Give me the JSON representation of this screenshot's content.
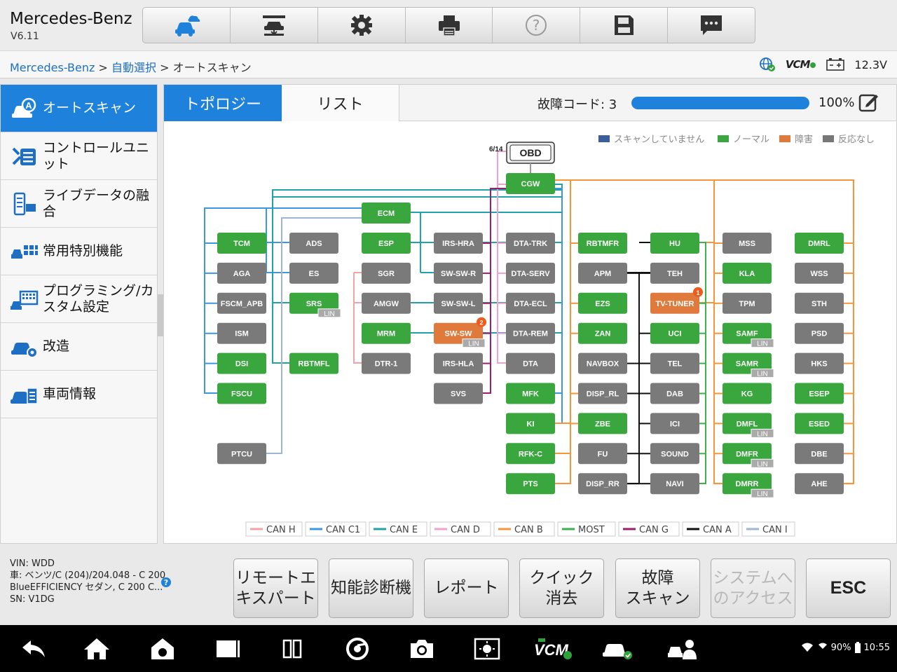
{
  "header": {
    "title": "Mercedes-Benz",
    "version": "V6.11",
    "toolbar": [
      {
        "name": "vehicle-diagnosis",
        "icon": "car-cloud-icon"
      },
      {
        "name": "lift",
        "icon": "car-lift-icon"
      },
      {
        "name": "settings",
        "icon": "gear-icon"
      },
      {
        "name": "print",
        "icon": "printer-icon"
      },
      {
        "name": "help",
        "icon": "question-icon"
      },
      {
        "name": "save",
        "icon": "save-icon"
      },
      {
        "name": "message",
        "icon": "chat-icon"
      }
    ]
  },
  "breadcrumb": {
    "part1": "Mercedes-Benz",
    "sep1": " > ",
    "part2": "自動選択",
    "sep2": " > ",
    "part3": "オートスキャン"
  },
  "status": {
    "vcm": "VCM",
    "voltage": "12.3V"
  },
  "sidebar": {
    "items": [
      {
        "label": "オートスキャン",
        "icon": "auto-scan-icon",
        "active": true
      },
      {
        "label": "コントロールユニット",
        "icon": "control-unit-icon"
      },
      {
        "label": "ライブデータの融合",
        "icon": "live-data-icon"
      },
      {
        "label": "常用特別機能",
        "icon": "special-function-icon"
      },
      {
        "label": "プログラミング/カスタム設定",
        "icon": "programming-icon"
      },
      {
        "label": "改造",
        "icon": "modify-icon"
      },
      {
        "label": "車両情報",
        "icon": "vehicle-info-icon"
      }
    ]
  },
  "tabs": {
    "topology": "トポロジー",
    "list": "リスト"
  },
  "scan": {
    "fault_label": "故障コード: 3",
    "progress": 100,
    "progress_text": "100%"
  },
  "legend_status": [
    {
      "label": "スキャンしていません",
      "color": "#3a5f9a"
    },
    {
      "label": "ノーマル",
      "color": "#3aa63e"
    },
    {
      "label": "障害",
      "color": "#e07a3c"
    },
    {
      "label": "反応なし",
      "color": "#777777"
    }
  ],
  "topology": {
    "obd": "OBD",
    "obd_count": "6/14",
    "status_colors": {
      "normal": "#3aa63e",
      "fault": "#e07a3c",
      "none": "#7a7a7a"
    },
    "nodes": [
      {
        "id": "CGW",
        "col": "g",
        "row": "cgw",
        "s": "normal"
      },
      {
        "id": "ECM",
        "col": "c",
        "row": "ecm",
        "s": "normal"
      },
      {
        "id": "TCM",
        "col": "a",
        "row": 0,
        "s": "normal"
      },
      {
        "id": "AGA",
        "col": "a",
        "row": 1,
        "s": "none"
      },
      {
        "id": "FSCM_APB",
        "col": "a",
        "row": 2,
        "s": "none"
      },
      {
        "id": "ISM",
        "col": "a",
        "row": 3,
        "s": "none"
      },
      {
        "id": "DSI",
        "col": "a",
        "row": 4,
        "s": "normal"
      },
      {
        "id": "FSCU",
        "col": "a",
        "row": 5,
        "s": "normal"
      },
      {
        "id": "PTCU",
        "col": "a",
        "row": 7,
        "s": "none"
      },
      {
        "id": "ADS",
        "col": "b",
        "row": 0,
        "s": "none"
      },
      {
        "id": "ES",
        "col": "b",
        "row": 1,
        "s": "none"
      },
      {
        "id": "SRS",
        "col": "b",
        "row": 2,
        "s": "normal",
        "lin": "LIN"
      },
      {
        "id": "RBTMFL",
        "col": "b",
        "row": 4,
        "s": "normal"
      },
      {
        "id": "ESP",
        "col": "c",
        "row": 0,
        "s": "normal"
      },
      {
        "id": "SGR",
        "col": "c",
        "row": 1,
        "s": "none"
      },
      {
        "id": "AMGW",
        "col": "c",
        "row": 2,
        "s": "none"
      },
      {
        "id": "MRM",
        "col": "c",
        "row": 3,
        "s": "normal"
      },
      {
        "id": "DTR-1",
        "col": "c",
        "row": 4,
        "s": "none"
      },
      {
        "id": "IRS-HRA",
        "col": "d",
        "row": 0,
        "s": "none"
      },
      {
        "id": "SW-SW-R",
        "col": "d",
        "row": 1,
        "s": "none"
      },
      {
        "id": "SW-SW-L",
        "col": "d",
        "row": 2,
        "s": "none"
      },
      {
        "id": "SW-SW",
        "col": "d",
        "row": 3,
        "s": "fault",
        "lin": "LIN",
        "badge": "2"
      },
      {
        "id": "IRS-HLA",
        "col": "d",
        "row": 4,
        "s": "none"
      },
      {
        "id": "SVS",
        "col": "d",
        "row": 5,
        "s": "none"
      },
      {
        "id": "DTA-TRK",
        "col": "e",
        "row": 0,
        "s": "none"
      },
      {
        "id": "DTA-SERV",
        "col": "e",
        "row": 1,
        "s": "none"
      },
      {
        "id": "DTA-ECL",
        "col": "e",
        "row": 2,
        "s": "none"
      },
      {
        "id": "DTA-REM",
        "col": "e",
        "row": 3,
        "s": "none"
      },
      {
        "id": "DTA",
        "col": "e",
        "row": 4,
        "s": "none"
      },
      {
        "id": "MFK",
        "col": "e",
        "row": 5,
        "s": "normal"
      },
      {
        "id": "KI",
        "col": "e",
        "row": 6,
        "s": "normal"
      },
      {
        "id": "RFK-C",
        "col": "e",
        "row": 7,
        "s": "normal"
      },
      {
        "id": "PTS",
        "col": "e",
        "row": 8,
        "s": "normal"
      },
      {
        "id": "RBTMFR",
        "col": "f",
        "row": 0,
        "s": "normal"
      },
      {
        "id": "APM",
        "col": "f",
        "row": 1,
        "s": "none"
      },
      {
        "id": "EZS",
        "col": "f",
        "row": 2,
        "s": "normal"
      },
      {
        "id": "ZAN",
        "col": "f",
        "row": 3,
        "s": "normal"
      },
      {
        "id": "NAVBOX",
        "col": "f",
        "row": 4,
        "s": "none"
      },
      {
        "id": "DISP_RL",
        "col": "f",
        "row": 5,
        "s": "none"
      },
      {
        "id": "ZBE",
        "col": "f",
        "row": 6,
        "s": "normal"
      },
      {
        "id": "FU",
        "col": "f",
        "row": 7,
        "s": "none"
      },
      {
        "id": "DISP_RR",
        "col": "f",
        "row": 8,
        "s": "none"
      },
      {
        "id": "HU",
        "col": "h",
        "row": 0,
        "s": "normal"
      },
      {
        "id": "TEH",
        "col": "h",
        "row": 1,
        "s": "none"
      },
      {
        "id": "TV-TUNER",
        "col": "h",
        "row": 2,
        "s": "fault",
        "badge": "1"
      },
      {
        "id": "UCI",
        "col": "h",
        "row": 3,
        "s": "normal"
      },
      {
        "id": "TEL",
        "col": "h",
        "row": 4,
        "s": "none"
      },
      {
        "id": "DAB",
        "col": "h",
        "row": 5,
        "s": "none"
      },
      {
        "id": "ICI",
        "col": "h",
        "row": 6,
        "s": "none"
      },
      {
        "id": "SOUND",
        "col": "h",
        "row": 7,
        "s": "none"
      },
      {
        "id": "NAVI",
        "col": "h",
        "row": 8,
        "s": "none"
      },
      {
        "id": "MSS",
        "col": "i",
        "row": 0,
        "s": "none"
      },
      {
        "id": "KLA",
        "col": "i",
        "row": 1,
        "s": "normal"
      },
      {
        "id": "TPM",
        "col": "i",
        "row": 2,
        "s": "none"
      },
      {
        "id": "SAMF",
        "col": "i",
        "row": 3,
        "s": "normal",
        "lin": "LIN"
      },
      {
        "id": "SAMR",
        "col": "i",
        "row": 4,
        "s": "normal",
        "lin": "LIN"
      },
      {
        "id": "KG",
        "col": "i",
        "row": 5,
        "s": "normal"
      },
      {
        "id": "DMFL",
        "col": "i",
        "row": 6,
        "s": "normal",
        "lin": "LIN"
      },
      {
        "id": "DMFR",
        "col": "i",
        "row": 7,
        "s": "normal",
        "lin": "LIN"
      },
      {
        "id": "DMRR",
        "col": "i",
        "row": 8,
        "s": "normal",
        "lin": "LIN"
      },
      {
        "id": "DMRL",
        "col": "j",
        "row": 0,
        "s": "normal"
      },
      {
        "id": "WSS",
        "col": "j",
        "row": 1,
        "s": "none"
      },
      {
        "id": "STH",
        "col": "j",
        "row": 2,
        "s": "none"
      },
      {
        "id": "PSD",
        "col": "j",
        "row": 3,
        "s": "none"
      },
      {
        "id": "HKS",
        "col": "j",
        "row": 4,
        "s": "none"
      },
      {
        "id": "ESEP",
        "col": "j",
        "row": 5,
        "s": "normal"
      },
      {
        "id": "ESED",
        "col": "j",
        "row": 6,
        "s": "normal"
      },
      {
        "id": "DBE",
        "col": "j",
        "row": 7,
        "s": "none"
      },
      {
        "id": "AHE",
        "col": "j",
        "row": 8,
        "s": "none"
      }
    ],
    "bus_legend": [
      {
        "label": "CAN H",
        "color": "#f4a3a3"
      },
      {
        "label": "CAN C1",
        "color": "#3c97e0"
      },
      {
        "label": "CAN E",
        "color": "#1fa3a8"
      },
      {
        "label": "CAN D",
        "color": "#f2a0cf"
      },
      {
        "label": "CAN B",
        "color": "#f5963a"
      },
      {
        "label": "MOST",
        "color": "#3bb24a"
      },
      {
        "label": "CAN G",
        "color": "#9a1f6e"
      },
      {
        "label": "CAN A",
        "color": "#111111"
      },
      {
        "label": "CAN I",
        "color": "#9eb6d4"
      }
    ]
  },
  "vehicle": {
    "vin": "VIN: WDD",
    "car": "車: ベンツ/C (204)/204.048 - C 200",
    "model": "BlueEFFICIENCY セダン, C 200 C...",
    "sn": "SN: V1DG"
  },
  "actions": [
    {
      "label": "リモートエキスパート",
      "l1": "リモートエ",
      "l2": "キスパート"
    },
    {
      "label": "知能診断機",
      "l1": "知能診断機",
      "l2": ""
    },
    {
      "label": "レポート",
      "l1": "レポート",
      "l2": ""
    },
    {
      "label": "クイック消去",
      "l1": "クイック",
      "l2": "消去"
    },
    {
      "label": "故障スキャン",
      "l1": "故障",
      "l2": "スキャン"
    },
    {
      "label": "システムへのアクセス",
      "l1": "システムへ",
      "l2": "のアクセス",
      "disabled": true
    },
    {
      "label": "ESC",
      "l1": "ESC",
      "l2": ""
    }
  ],
  "system": {
    "battery": "90%",
    "time": "10:55"
  }
}
